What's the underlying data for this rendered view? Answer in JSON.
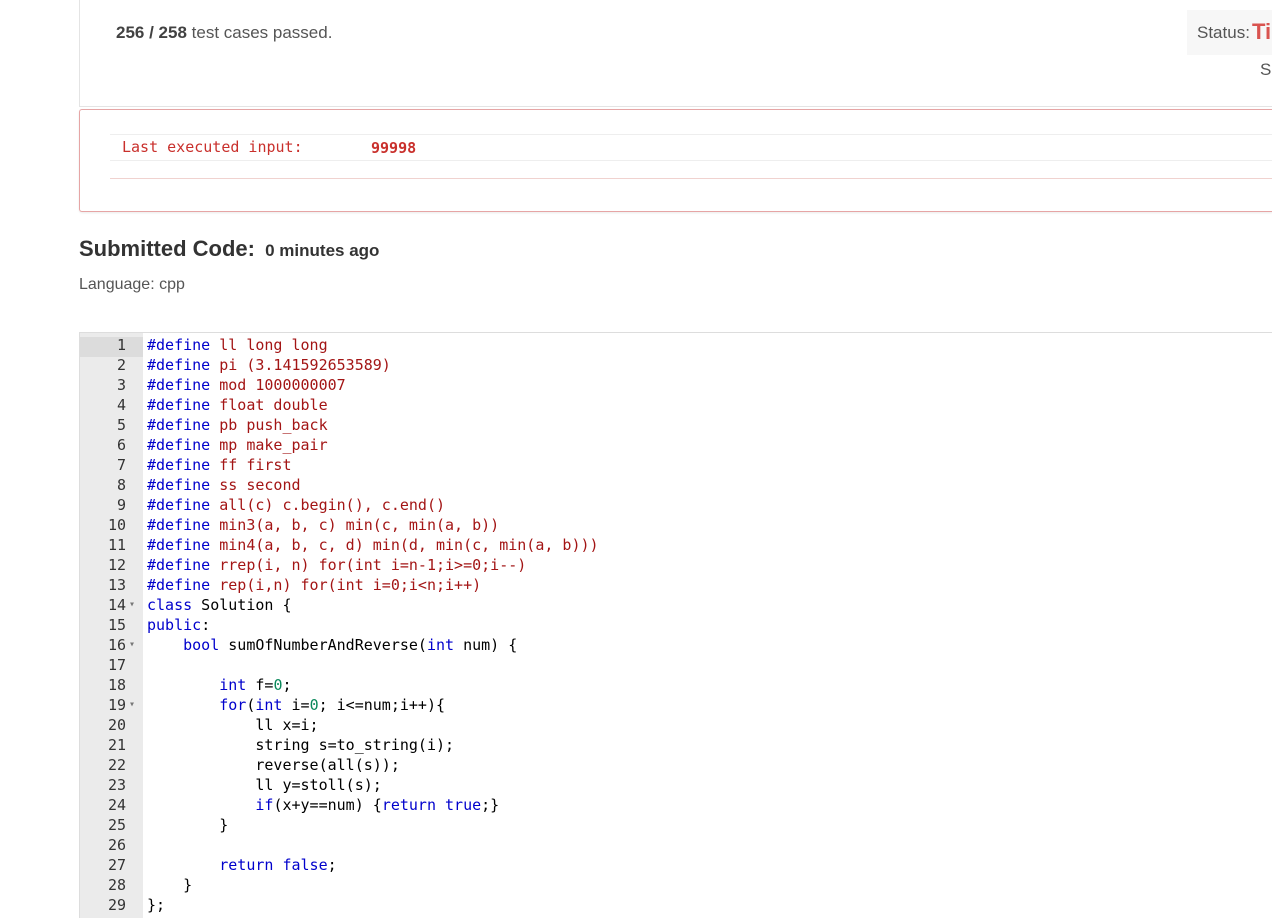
{
  "header": {
    "passed_count": "256 / 258",
    "passed_suffix": "test cases passed.",
    "status_label": "Status:",
    "status_value": "Ti",
    "sub_fragment": "S"
  },
  "error": {
    "label": "Last executed input:",
    "value": "99998"
  },
  "submission": {
    "title": "Submitted Code:",
    "time": "0 minutes ago",
    "language": "Language: cpp"
  },
  "code_lines": [
    "#define ll long long",
    "#define pi (3.141592653589)",
    "#define mod 1000000007",
    "#define float double",
    "#define pb push_back",
    "#define mp make_pair",
    "#define ff first",
    "#define ss second",
    "#define all(c) c.begin(), c.end()",
    "#define min3(a, b, c) min(c, min(a, b))",
    "#define min4(a, b, c, d) min(d, min(c, min(a, b)))",
    "#define rrep(i, n) for(int i=n-1;i>=0;i--)",
    "#define rep(i,n) for(int i=0;i<n;i++)",
    "class Solution {",
    "public:",
    "    bool sumOfNumberAndReverse(int num) {",
    "",
    "        int f=0;",
    "        for(int i=0; i<=num;i++){",
    "            ll x=i;",
    "            string s=to_string(i);",
    "            reverse(all(s));",
    "            ll y=stoll(s);",
    "            if(x+y==num) {return true;}",
    "        }",
    "",
    "        return false;",
    "    }",
    "};"
  ],
  "fold_lines": [
    14,
    16,
    19
  ]
}
